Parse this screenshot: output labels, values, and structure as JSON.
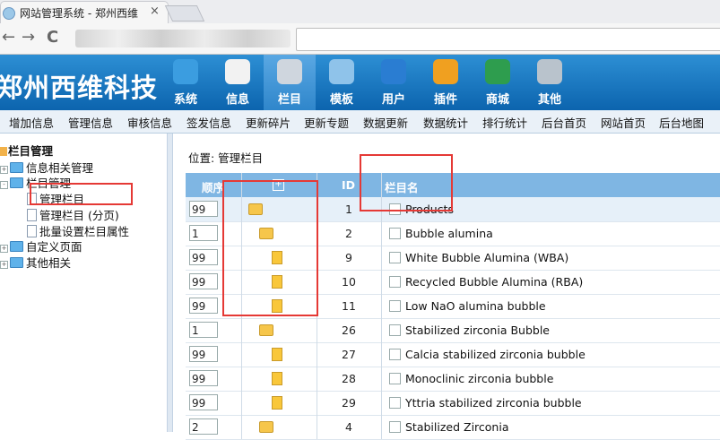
{
  "browser": {
    "tab_title": "网站管理系统 - 郑州西维",
    "tab_close": "×",
    "back": "←",
    "forward": "→",
    "reload": "C"
  },
  "brand": "郑州西维科技",
  "topnav": [
    {
      "label": "系统",
      "icon": "globe-icon",
      "color": "#3b9de0"
    },
    {
      "label": "信息",
      "icon": "notepad-icon",
      "color": "#f2f2f2"
    },
    {
      "label": "栏目",
      "icon": "folder-icon",
      "color": "#cfd6de"
    },
    {
      "label": "模板",
      "icon": "window-icon",
      "color": "#8fc3ea"
    },
    {
      "label": "用户",
      "icon": "user-icon",
      "color": "#2a7dd2"
    },
    {
      "label": "插件",
      "icon": "tools-icon",
      "color": "#f0a020"
    },
    {
      "label": "商城",
      "icon": "card-icon",
      "color": "#2e9d4e"
    },
    {
      "label": "其他",
      "icon": "gear-icon",
      "color": "#b9c3cc"
    }
  ],
  "submenu": [
    "增加信息",
    "管理信息",
    "审核信息",
    "签发信息",
    "更新碎片",
    "更新专题",
    "数据更新",
    "数据统计",
    "排行统计",
    "后台首页",
    "网站首页",
    "后台地图"
  ],
  "tree": {
    "root": "栏目管理",
    "items": [
      {
        "label": "信息相关管理"
      },
      {
        "label": "栏目管理"
      },
      {
        "label": "管理栏目"
      },
      {
        "label": "管理栏目 (分页)"
      },
      {
        "label": "批量设置栏目属性"
      },
      {
        "label": "自定义页面"
      },
      {
        "label": "其他相关"
      }
    ]
  },
  "location": "位置: 管理栏目",
  "grid": {
    "headers": {
      "order": "顺序",
      "expand": "+",
      "id": "ID",
      "name": "栏目名"
    },
    "rows": [
      {
        "order": "99",
        "type": "folder",
        "level": 0,
        "id": "1",
        "name": "Products"
      },
      {
        "order": "1",
        "type": "folder",
        "level": 1,
        "id": "2",
        "name": "Bubble alumina"
      },
      {
        "order": "99",
        "type": "file",
        "level": 2,
        "id": "9",
        "name": "White Bubble Alumina (WBA)"
      },
      {
        "order": "99",
        "type": "file",
        "level": 2,
        "id": "10",
        "name": "Recycled Bubble Alumina (RBA)"
      },
      {
        "order": "99",
        "type": "file",
        "level": 2,
        "id": "11",
        "name": "Low NaO alumina bubble"
      },
      {
        "order": "1",
        "type": "folder",
        "level": 1,
        "id": "26",
        "name": "Stabilized zirconia Bubble"
      },
      {
        "order": "99",
        "type": "file",
        "level": 2,
        "id": "27",
        "name": "Calcia stabilized zirconia bubble"
      },
      {
        "order": "99",
        "type": "file",
        "level": 2,
        "id": "28",
        "name": "Monoclinic zirconia bubble"
      },
      {
        "order": "99",
        "type": "file",
        "level": 2,
        "id": "29",
        "name": "Yttria stabilized zirconia bubble"
      },
      {
        "order": "2",
        "type": "folder",
        "level": 1,
        "id": "4",
        "name": "Stabilized Zirconia"
      }
    ]
  }
}
